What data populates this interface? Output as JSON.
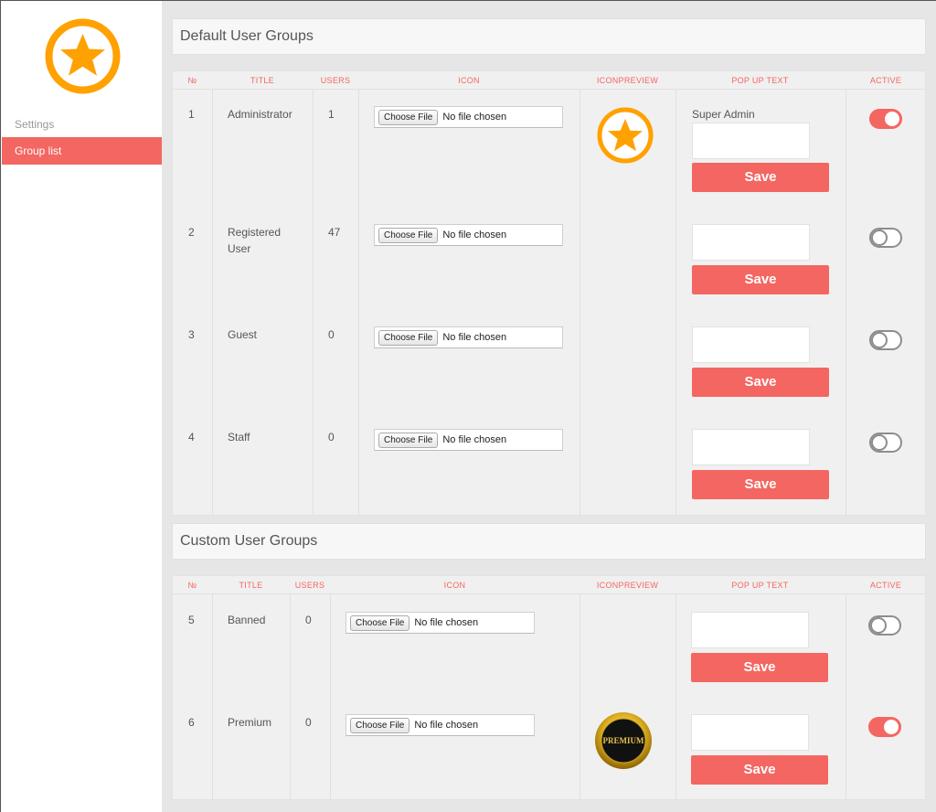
{
  "sidebar": {
    "logo_icon": "star-circle-icon",
    "items": [
      {
        "label": "Settings"
      },
      {
        "label": "Group list"
      }
    ]
  },
  "sections": {
    "default_title": "Default User Groups",
    "custom_title": "Custom User Groups"
  },
  "table_headers": {
    "num": "№",
    "title": "TITLE",
    "users": "USERS",
    "icon": "ICON",
    "iconpreview": "ICONPREVIEW",
    "popup": "POP UP TEXT",
    "active": "ACTIVE"
  },
  "file_input": {
    "button_label": "Choose File",
    "status": "No file chosen"
  },
  "save_label": "Save",
  "default_groups": [
    {
      "num": "1",
      "title": "Administrator",
      "users": "1",
      "popup_text": "Super Admin",
      "preview": "star-icon",
      "active": true
    },
    {
      "num": "2",
      "title": "Registered User",
      "users": "47",
      "popup_text": "",
      "preview": "",
      "active": false
    },
    {
      "num": "3",
      "title": "Guest",
      "users": "0",
      "popup_text": "",
      "preview": "",
      "active": false
    },
    {
      "num": "4",
      "title": "Staff",
      "users": "0",
      "popup_text": "",
      "preview": "",
      "active": false
    }
  ],
  "custom_groups": [
    {
      "num": "5",
      "title": "Banned",
      "users": "0",
      "popup_text": "",
      "preview": "",
      "active": false
    },
    {
      "num": "6",
      "title": "Premium",
      "users": "0",
      "popup_text": "",
      "preview": "premium-badge-icon",
      "preview_label": "PREMIUM",
      "active": true
    }
  ],
  "colors": {
    "accent": "#f46661",
    "star_orange": "#ffa100"
  }
}
